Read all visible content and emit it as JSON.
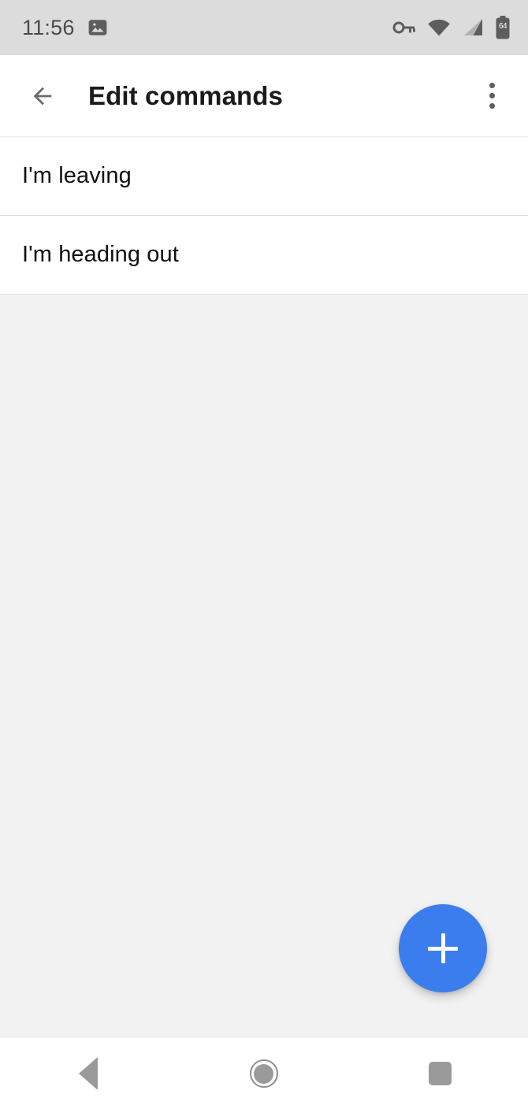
{
  "status_bar": {
    "time": "11:56",
    "icons_left": [
      "photo-icon"
    ],
    "icons_right": [
      "vpn-key-icon",
      "wifi-icon",
      "cell-signal-icon",
      "battery-icon"
    ],
    "battery_level": "64"
  },
  "app_bar": {
    "back_label": "back-arrow-icon",
    "title": "Edit commands",
    "overflow_label": "overflow-menu-icon"
  },
  "commands": [
    {
      "label": "I'm leaving"
    },
    {
      "label": "I'm heading out"
    }
  ],
  "fab": {
    "label": "+",
    "color": "#3b7ded"
  },
  "nav_bar": {
    "back": "back-nav-button",
    "home": "home-nav-button",
    "recents": "recents-nav-button"
  },
  "colors": {
    "status_bar_bg": "#dcdcdc",
    "app_bar_bg": "#ffffff",
    "content_bg": "#f2f2f2",
    "list_bg": "#ffffff",
    "divider": "#dddddd",
    "accent": "#3b7ded",
    "nav_icon": "#9a9a9a"
  }
}
